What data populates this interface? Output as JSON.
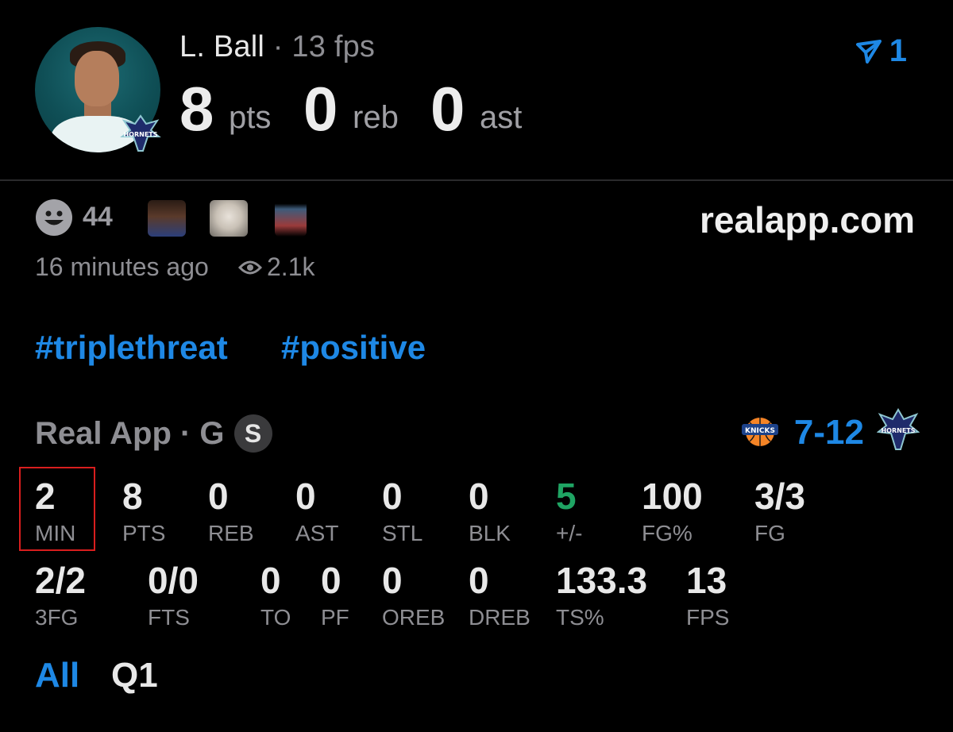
{
  "player": {
    "name": "L. Ball",
    "separator": "·",
    "fps_label": "13 fps",
    "team_logo_text": "HORNETS"
  },
  "summary": {
    "pts_value": "8",
    "pts_unit": "pts",
    "reb_value": "0",
    "reb_unit": "reb",
    "ast_value": "0",
    "ast_unit": "ast"
  },
  "share": {
    "count": "1",
    "icon": "share-icon"
  },
  "reactions": {
    "count": "44",
    "icon": "smiley-icon"
  },
  "site": "realapp.com",
  "meta": {
    "time": "16 minutes ago",
    "views": "2.1k",
    "views_icon": "eye-icon"
  },
  "tags": [
    "#triplethreat",
    "#positive"
  ],
  "game": {
    "league": "Real App · G",
    "badge": "S",
    "score": "7-12",
    "away_logo_text": "KNICKS",
    "home_logo_text": "HORNETS"
  },
  "stats_row1": [
    {
      "value": "2",
      "label": "MIN"
    },
    {
      "value": "8",
      "label": "PTS"
    },
    {
      "value": "0",
      "label": "REB"
    },
    {
      "value": "0",
      "label": "AST"
    },
    {
      "value": "0",
      "label": "STL"
    },
    {
      "value": "0",
      "label": "BLK"
    },
    {
      "value": "5",
      "label": "+/-"
    },
    {
      "value": "100",
      "label": "FG%"
    },
    {
      "value": "3/3",
      "label": "FG"
    }
  ],
  "stats_row2": [
    {
      "value": "2/2",
      "label": "3FG"
    },
    {
      "value": "0/0",
      "label": "FTS"
    },
    {
      "value": "0",
      "label": "TO"
    },
    {
      "value": "0",
      "label": "PF"
    },
    {
      "value": "0",
      "label": "OREB"
    },
    {
      "value": "0",
      "label": "DREB"
    },
    {
      "value": "133.3",
      "label": "TS%"
    },
    {
      "value": "13",
      "label": "FPS"
    }
  ],
  "filters": [
    "All",
    "Q1"
  ],
  "colors": {
    "accent": "#1e88e5",
    "positive": "#1fa463",
    "highlight": "#d91e1e",
    "muted": "#8e8e93"
  }
}
